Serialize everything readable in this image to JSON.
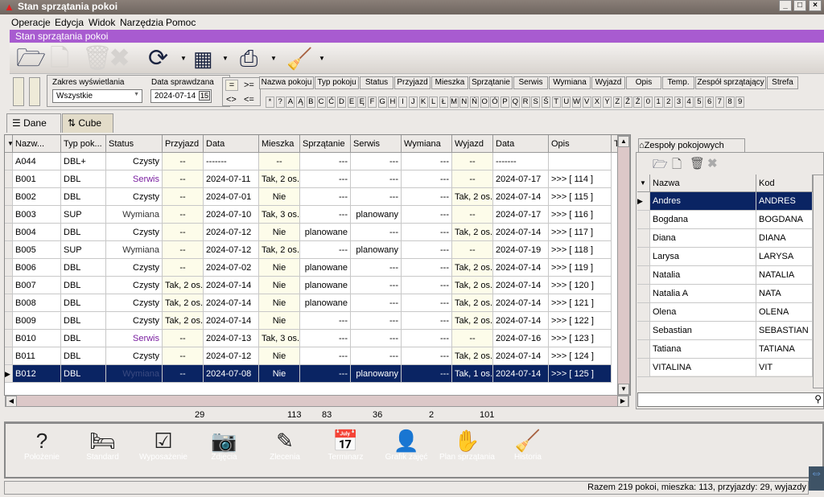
{
  "window": {
    "title": "Stan sprzątania pokoi",
    "controls": [
      "_",
      "□",
      "×"
    ]
  },
  "menu": [
    "Operacje",
    "Edycja",
    "Widok",
    "Narzędzia",
    "Pomoc"
  ],
  "banner": "Stan sprzątania pokoi",
  "toolbar": {
    "icons": [
      "open-folder-icon",
      "new-document-icon",
      "delete-icon",
      "cancel-icon",
      "refresh-icon",
      "export-icon",
      "print-icon",
      "broom-icon"
    ]
  },
  "filter": {
    "range_label": "Zakres wyświetlania",
    "range_value": "Wszystkie",
    "date_label": "Data sprawdzana",
    "date_value": "2024-07-14",
    "calendar": "15",
    "ops": [
      "=",
      ">=",
      "<>",
      "<="
    ]
  },
  "sort_tabs": [
    "Nazwa pokoju",
    "Typ pokoju",
    "Status",
    "Przyjazd",
    "Mieszka",
    "Sprzątanie",
    "Serwis",
    "Wymiana",
    "Wyjazd",
    "Opis",
    "Temp.",
    "Zespół sprzątający",
    "Strefa"
  ],
  "letters": [
    "*",
    "?",
    "A",
    "Ą",
    "B",
    "C",
    "Ć",
    "D",
    "E",
    "Ę",
    "F",
    "G",
    "H",
    "I",
    "J",
    "K",
    "L",
    "Ł",
    "M",
    "N",
    "Ń",
    "O",
    "Ó",
    "P",
    "Q",
    "R",
    "S",
    "Ś",
    "T",
    "U",
    "W",
    "V",
    "X",
    "Y",
    "Z",
    "Ź",
    "Ż",
    "0",
    "1",
    "2",
    "3",
    "4",
    "5",
    "6",
    "7",
    "8",
    "9"
  ],
  "view_tabs": [
    "Dane",
    "Cube"
  ],
  "grid": {
    "columns": [
      "Nazw...",
      "Typ pok...",
      "Status",
      "Przyjazd",
      "Data",
      "Mieszka",
      "Sprzątanie",
      "Serwis",
      "Wymiana",
      "Wyjazd",
      "Data",
      "Opis",
      "T"
    ],
    "rows": [
      [
        "A044",
        "DBL+",
        "Czysty",
        "--",
        "-------",
        "--",
        "---",
        "---",
        "---",
        "--",
        "-------",
        ""
      ],
      [
        "B001",
        "DBL",
        "Serwis",
        "--",
        "2024-07-11",
        "Tak, 2 os.",
        "---",
        "---",
        "---",
        "--",
        "2024-07-17",
        ">>> [ 114 ]"
      ],
      [
        "B002",
        "DBL",
        "Czysty",
        "--",
        "2024-07-01",
        "Nie",
        "---",
        "---",
        "---",
        "Tak, 2 os.",
        "2024-07-14",
        ">>> [ 115 ]"
      ],
      [
        "B003",
        "SUP",
        "Wymiana",
        "--",
        "2024-07-10",
        "Tak, 3 os.",
        "---",
        "planowany",
        "---",
        "--",
        "2024-07-17",
        ">>> [ 116 ]"
      ],
      [
        "B004",
        "DBL",
        "Czysty",
        "--",
        "2024-07-12",
        "Nie",
        "planowane",
        "---",
        "---",
        "Tak, 2 os.",
        "2024-07-14",
        ">>> [ 117 ]"
      ],
      [
        "B005",
        "SUP",
        "Wymiana",
        "--",
        "2024-07-12",
        "Tak, 2 os.",
        "---",
        "planowany",
        "---",
        "--",
        "2024-07-19",
        ">>> [ 118 ]"
      ],
      [
        "B006",
        "DBL",
        "Czysty",
        "--",
        "2024-07-02",
        "Nie",
        "planowane",
        "---",
        "---",
        "Tak, 2 os.",
        "2024-07-14",
        ">>> [ 119 ]"
      ],
      [
        "B007",
        "DBL",
        "Czysty",
        "Tak, 2 os.",
        "2024-07-14",
        "Nie",
        "planowane",
        "---",
        "---",
        "Tak, 2 os.",
        "2024-07-14",
        ">>> [ 120 ]"
      ],
      [
        "B008",
        "DBL",
        "Czysty",
        "Tak, 2 os.",
        "2024-07-14",
        "Nie",
        "planowane",
        "---",
        "---",
        "Tak, 2 os.",
        "2024-07-14",
        ">>> [ 121 ]"
      ],
      [
        "B009",
        "DBL",
        "Czysty",
        "Tak, 2 os.",
        "2024-07-14",
        "Nie",
        "---",
        "---",
        "---",
        "Tak, 2 os.",
        "2024-07-14",
        ">>> [ 122 ]"
      ],
      [
        "B010",
        "DBL",
        "Serwis",
        "--",
        "2024-07-13",
        "Tak, 3 os.",
        "---",
        "---",
        "---",
        "--",
        "2024-07-16",
        ">>> [ 123 ]"
      ],
      [
        "B011",
        "DBL",
        "Czysty",
        "--",
        "2024-07-12",
        "Nie",
        "---",
        "---",
        "---",
        "Tak, 2 os.",
        "2024-07-14",
        ">>> [ 124 ]"
      ],
      [
        "B012",
        "DBL",
        "Wymiana",
        "--",
        "2024-07-08",
        "Nie",
        "---",
        "planowany",
        "---",
        "Tak, 1 os.",
        "2024-07-14",
        ">>> [ 125 ]"
      ]
    ],
    "selected_row": "B012",
    "status_colors": {
      "Serwis": "#7a1fa0",
      "Czysty": "#000000",
      "Wymiana": "#333333"
    },
    "totals": {
      "Przyjazd": "29",
      "Mieszka": "113",
      "Sprzątanie": "83",
      "Serwis": "36",
      "Wymiana": "2",
      "Wyjazd": "101"
    }
  },
  "teams": {
    "tab": "Zespoły pokojowych",
    "columns": [
      "Nazwa",
      "Kod"
    ],
    "rows": [
      [
        "Andres",
        "ANDRES"
      ],
      [
        "Bogdana",
        "BOGDANA"
      ],
      [
        "Diana",
        "DIANA"
      ],
      [
        "Larysa",
        "LARYSA"
      ],
      [
        "Natalia",
        "NATALIA"
      ],
      [
        "Natalia A",
        "NATA"
      ],
      [
        "Olena",
        "OLENA"
      ],
      [
        "Sebastian",
        "SEBASTIAN"
      ],
      [
        "Tatiana",
        "TATIANA"
      ],
      [
        "VITALINA",
        "VIT"
      ]
    ],
    "selected_row": "Andres"
  },
  "actions": [
    {
      "label": "Położenie",
      "icon": "bed-question-icon"
    },
    {
      "label": "Standard",
      "icon": "beds-icon"
    },
    {
      "label": "Wyposażenie",
      "icon": "checklist-bed-icon"
    },
    {
      "label": "Zdjęcia",
      "icon": "camera-icon"
    },
    {
      "label": "Zlecenia",
      "icon": "bed-pencil-icon"
    },
    {
      "label": "Terminarz",
      "icon": "calendar-icon"
    },
    {
      "label": "Grafik zajęć",
      "icon": "schedule-person-icon"
    },
    {
      "label": "Plan sprzątania",
      "icon": "hand-icon"
    },
    {
      "label": "Historia",
      "icon": "document-broom-icon"
    }
  ],
  "status_bar": "Razem 219 pokoi,  mieszka: 113, przyjazdy: 29, wyjazdy"
}
